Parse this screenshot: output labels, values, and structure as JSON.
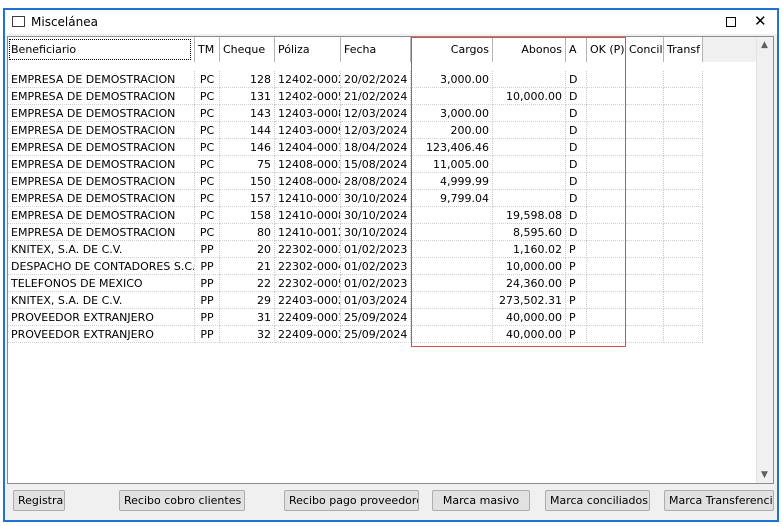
{
  "window": {
    "title": "Miscelánea",
    "maximize_glyph": "☐",
    "close_glyph": "✕"
  },
  "columns": {
    "beneficiario": "Beneficiario",
    "tm": "TM",
    "cheque": "Cheque",
    "poliza": "Póliza",
    "fecha": "Fecha",
    "cargos": "Cargos",
    "abonos": "Abonos",
    "a": "A",
    "ok": "OK (P)",
    "concil": "Concil",
    "transf": "Transf"
  },
  "rows": [
    {
      "beneficiario": "EMPRESA DE DEMOSTRACION",
      "tm": "PC",
      "cheque": "128",
      "poliza": "12402-0002",
      "fecha": "20/02/2024",
      "cargos": "3,000.00",
      "abonos": "",
      "a": "D"
    },
    {
      "beneficiario": "EMPRESA DE DEMOSTRACION",
      "tm": "PC",
      "cheque": "131",
      "poliza": "12402-0005",
      "fecha": "21/02/2024",
      "cargos": "",
      "abonos": "10,000.00",
      "a": "D"
    },
    {
      "beneficiario": "EMPRESA DE DEMOSTRACION",
      "tm": "PC",
      "cheque": "143",
      "poliza": "12403-0008",
      "fecha": "12/03/2024",
      "cargos": "3,000.00",
      "abonos": "",
      "a": "D"
    },
    {
      "beneficiario": "EMPRESA DE DEMOSTRACION",
      "tm": "PC",
      "cheque": "144",
      "poliza": "12403-0009",
      "fecha": "12/03/2024",
      "cargos": "200.00",
      "abonos": "",
      "a": "D"
    },
    {
      "beneficiario": "EMPRESA DE DEMOSTRACION",
      "tm": "PC",
      "cheque": "146",
      "poliza": "12404-0001",
      "fecha": "18/04/2024",
      "cargos": "123,406.46",
      "abonos": "",
      "a": "D"
    },
    {
      "beneficiario": "EMPRESA DE DEMOSTRACION",
      "tm": "PC",
      "cheque": "75",
      "poliza": "12408-0003",
      "fecha": "15/08/2024",
      "cargos": "11,005.00",
      "abonos": "",
      "a": "D"
    },
    {
      "beneficiario": "EMPRESA DE DEMOSTRACION",
      "tm": "PC",
      "cheque": "150",
      "poliza": "12408-0004",
      "fecha": "28/08/2024",
      "cargos": "4,999.99",
      "abonos": "",
      "a": "D"
    },
    {
      "beneficiario": "EMPRESA DE DEMOSTRACION",
      "tm": "PC",
      "cheque": "157",
      "poliza": "12410-0007",
      "fecha": "30/10/2024",
      "cargos": "9,799.04",
      "abonos": "",
      "a": "D"
    },
    {
      "beneficiario": "EMPRESA DE DEMOSTRACION",
      "tm": "PC",
      "cheque": "158",
      "poliza": "12410-0008",
      "fecha": "30/10/2024",
      "cargos": "",
      "abonos": "19,598.08",
      "a": "D"
    },
    {
      "beneficiario": "EMPRESA DE DEMOSTRACION",
      "tm": "PC",
      "cheque": "80",
      "poliza": "12410-0012",
      "fecha": "30/10/2024",
      "cargos": "",
      "abonos": "8,595.60",
      "a": "D"
    },
    {
      "beneficiario": "KNITEX, S.A. DE C.V.",
      "tm": "PP",
      "cheque": "20",
      "poliza": "22302-0003",
      "fecha": "01/02/2023",
      "cargos": "",
      "abonos": "1,160.02",
      "a": "P"
    },
    {
      "beneficiario": "DESPACHO DE CONTADORES S.C.",
      "tm": "PP",
      "cheque": "21",
      "poliza": "22302-0004",
      "fecha": "01/02/2023",
      "cargos": "",
      "abonos": "10,000.00",
      "a": "P"
    },
    {
      "beneficiario": "TELEFONOS DE MEXICO",
      "tm": "PP",
      "cheque": "22",
      "poliza": "22302-0005",
      "fecha": "01/02/2023",
      "cargos": "",
      "abonos": "24,360.00",
      "a": "P"
    },
    {
      "beneficiario": "KNITEX, S.A. DE C.V.",
      "tm": "PP",
      "cheque": "29",
      "poliza": "22403-0002",
      "fecha": "01/03/2024",
      "cargos": "",
      "abonos": "273,502.31",
      "a": "P"
    },
    {
      "beneficiario": "PROVEEDOR EXTRANJERO",
      "tm": "PP",
      "cheque": "31",
      "poliza": "22409-0001",
      "fecha": "25/09/2024",
      "cargos": "",
      "abonos": "40,000.00",
      "a": "P"
    },
    {
      "beneficiario": "PROVEEDOR EXTRANJERO",
      "tm": "PP",
      "cheque": "32",
      "poliza": "22409-0002",
      "fecha": "25/09/2024",
      "cargos": "",
      "abonos": "40,000.00",
      "a": "P"
    }
  ],
  "scrollbar": {
    "up_glyph": "▲",
    "down_glyph": "▼"
  },
  "buttons": {
    "registrar": "Registrar",
    "recibo_cobro": "Recibo cobro clientes",
    "recibo_pago": "Recibo pago proveedores",
    "marca_masivo": "Marca masivo",
    "marca_conciliados": "Marca conciliados",
    "marca_transferencias": "Marca Transferencias"
  },
  "colors": {
    "window_border": "#1e73d2",
    "highlight_box": "#e04a4a"
  }
}
